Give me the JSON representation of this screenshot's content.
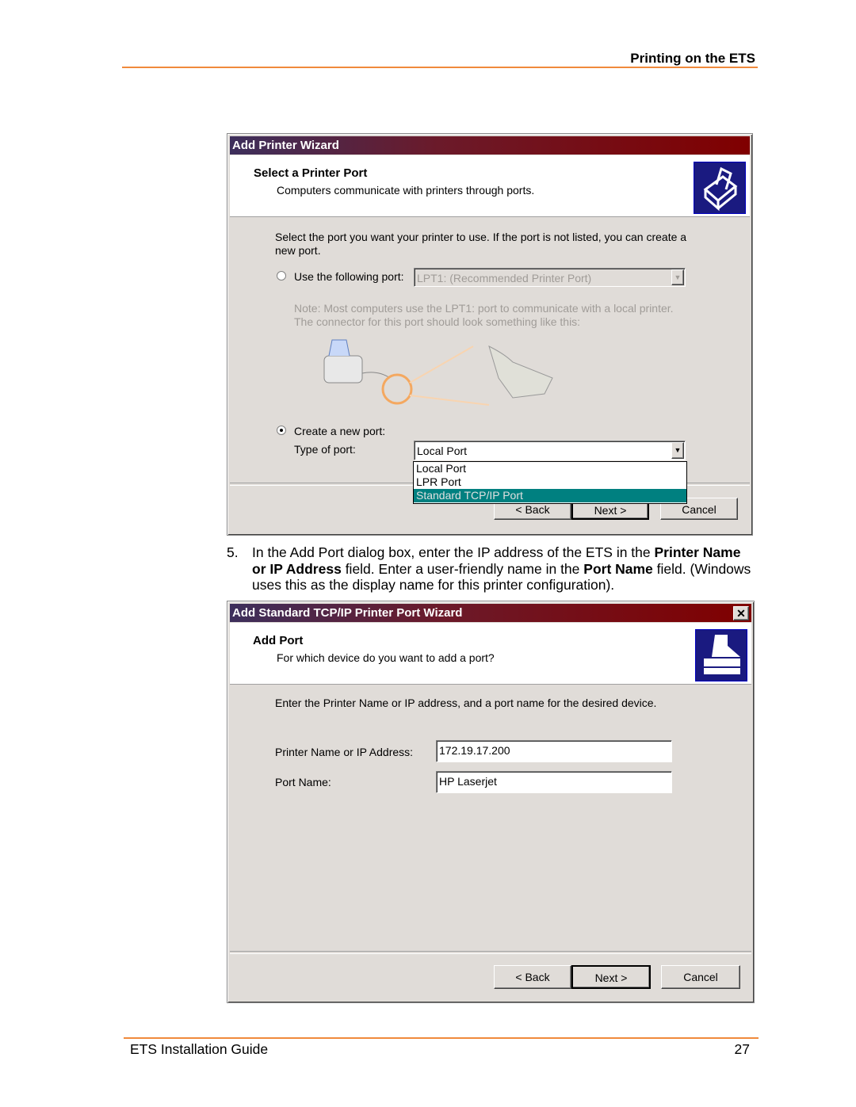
{
  "page_header": "Printing on the ETS",
  "dialog1": {
    "title": "Add Printer Wizard",
    "heading": "Select a Printer Port",
    "subheading": "Computers communicate with printers through ports.",
    "instructions": "Select the port you want your printer to use.  If the port is not listed, you can create a new port.",
    "use_port_label": "Use the following port:",
    "use_port_value": "LPT1: (Recommended Printer Port)",
    "note": "Note: Most computers use the LPT1: port to communicate with a local printer. The connector for this port should look something like this:",
    "create_port_label": "Create a new port:",
    "type_label": "Type of port:",
    "type_value": "Local Port",
    "options": [
      "Local Port",
      "LPR Port",
      "Standard TCP/IP Port"
    ],
    "selected_option": "Standard TCP/IP Port",
    "back": "< Back",
    "next": "Next >",
    "cancel": "Cancel",
    "selection_color": "#008080"
  },
  "step": {
    "number": "5.",
    "t1": "In the Add Port dialog box, enter the IP address of the ETS in the ",
    "b1": "Printer Name or IP Address",
    "t2": " field.  Enter a user-friendly name in the ",
    "b2": "Port Name",
    "t3": " field. (Windows uses this as the display name for this printer configuration)."
  },
  "dialog2": {
    "title": "Add Standard TCP/IP Printer Port Wizard",
    "heading": "Add Port",
    "subheading": "For which device do you want to add a port?",
    "instructions": "Enter the Printer Name or IP address, and a port name for the desired device.",
    "ip_label": "Printer Name or IP Address:",
    "ip_value": "172.19.17.200",
    "port_label": "Port Name:",
    "port_value": "HP Laserjet",
    "back": "< Back",
    "next": "Next >",
    "cancel": "Cancel"
  },
  "footer": {
    "left": "ETS Installation Guide",
    "page": "27"
  },
  "accent_color": "#f08a3c"
}
